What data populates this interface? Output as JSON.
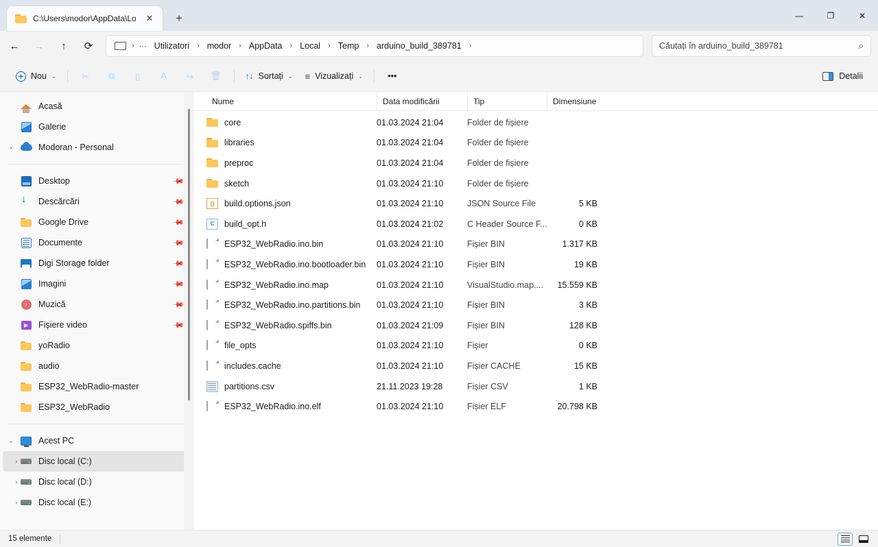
{
  "window": {
    "tab_title": "C:\\Users\\modor\\AppData\\Loc",
    "tab_close_label": "✕",
    "new_tab_label": "+",
    "minimize_label": "—",
    "maximize_label": "❐",
    "close_label": "✕"
  },
  "nav": {
    "back_label": "←",
    "forward_label": "→",
    "up_label": "↑",
    "refresh_label": "⟳"
  },
  "breadcrumb": {
    "overflow_label": "⋯",
    "separator": "›",
    "items": [
      {
        "label": "Utilizatori"
      },
      {
        "label": "modor"
      },
      {
        "label": "AppData"
      },
      {
        "label": "Local"
      },
      {
        "label": "Temp"
      },
      {
        "label": "arduino_build_389781"
      }
    ]
  },
  "search": {
    "placeholder": "Căutați în arduino_build_389781",
    "value": "",
    "icon_label": "⌕"
  },
  "toolbar": {
    "new_label": "Nou",
    "chevron": "⌄",
    "cut_label": "✂",
    "copy_label": "⧉",
    "paste_label": "▯",
    "rename_label": "A",
    "share_label": "↪",
    "delete_label": "🗑",
    "sort_label": "Sortați",
    "sort_icon": "↑↓",
    "view_label": "Vizualizați",
    "view_icon": "≡",
    "more_label": "•••",
    "details_label": "Detalii"
  },
  "sidebar": {
    "quick": [
      {
        "label": "Acasă",
        "icon": "home-icon",
        "chevron": "",
        "pinned": false
      },
      {
        "label": "Galerie",
        "icon": "gallery-icon",
        "chevron": "",
        "pinned": false
      },
      {
        "label": "Modoran - Personal",
        "icon": "onedrive-cloud-icon",
        "chevron": "›",
        "pinned": false
      }
    ],
    "pinned": [
      {
        "label": "Desktop",
        "icon": "desktop-icon",
        "pinned": true
      },
      {
        "label": "Descărcări",
        "icon": "downloads-icon",
        "pinned": true
      },
      {
        "label": "Google Drive",
        "icon": "folder-icon",
        "pinned": true
      },
      {
        "label": "Documente",
        "icon": "documents-icon",
        "pinned": true
      },
      {
        "label": "Digi Storage folder",
        "icon": "digi-storage-icon",
        "pinned": true
      },
      {
        "label": "Imagini",
        "icon": "pictures-icon",
        "pinned": true
      },
      {
        "label": "Muzică",
        "icon": "music-icon",
        "pinned": true
      },
      {
        "label": "Fișiere video",
        "icon": "video-icon",
        "pinned": true
      },
      {
        "label": "yoRadio",
        "icon": "folder-icon",
        "pinned": false
      },
      {
        "label": "audio",
        "icon": "folder-icon",
        "pinned": false
      },
      {
        "label": "ESP32_WebRadio-master",
        "icon": "folder-icon",
        "pinned": false
      },
      {
        "label": "ESP32_WebRadio",
        "icon": "folder-icon",
        "pinned": false
      }
    ],
    "thispc": {
      "label": "Acest PC",
      "chevron": "⌄",
      "icon": "this-pc-icon"
    },
    "drives": [
      {
        "label": "Disc local (C:)",
        "chevron": "›",
        "icon": "drive-icon",
        "selected": true
      },
      {
        "label": "Disc local (D:)",
        "chevron": "›",
        "icon": "drive-icon",
        "selected": false
      },
      {
        "label": "Disc local (E:)",
        "chevron": "›",
        "icon": "drive-icon",
        "selected": false
      }
    ],
    "pin_glyph": "📌"
  },
  "filelist": {
    "columns": {
      "name": "Nume",
      "date": "Data modificării",
      "type": "Tip",
      "size": "Dimensiune"
    },
    "sort_caret": "⌃",
    "rows": [
      {
        "name": "core",
        "date": "01.03.2024 21:04",
        "type": "Folder de fișiere",
        "size": "",
        "icon": "folder"
      },
      {
        "name": "libraries",
        "date": "01.03.2024 21:04",
        "type": "Folder de fișiere",
        "size": "",
        "icon": "folder"
      },
      {
        "name": "preproc",
        "date": "01.03.2024 21:04",
        "type": "Folder de fișiere",
        "size": "",
        "icon": "folder"
      },
      {
        "name": "sketch",
        "date": "01.03.2024 21:10",
        "type": "Folder de fișiere",
        "size": "",
        "icon": "folder"
      },
      {
        "name": "build.options.json",
        "date": "01.03.2024 21:10",
        "type": "JSON Source File",
        "size": "5 KB",
        "icon": "json"
      },
      {
        "name": "build_opt.h",
        "date": "01.03.2024 21:02",
        "type": "C Header Source F...",
        "size": "0 KB",
        "icon": "c"
      },
      {
        "name": "ESP32_WebRadio.ino.bin",
        "date": "01.03.2024 21:10",
        "type": "Fișier BIN",
        "size": "1.317 KB",
        "icon": "file"
      },
      {
        "name": "ESP32_WebRadio.ino.bootloader.bin",
        "date": "01.03.2024 21:10",
        "type": "Fișier BIN",
        "size": "19 KB",
        "icon": "file"
      },
      {
        "name": "ESP32_WebRadio.ino.map",
        "date": "01.03.2024 21:10",
        "type": "VisualStudio.map....",
        "size": "15.559 KB",
        "icon": "file"
      },
      {
        "name": "ESP32_WebRadio.ino.partitions.bin",
        "date": "01.03.2024 21:10",
        "type": "Fișier BIN",
        "size": "3 KB",
        "icon": "file"
      },
      {
        "name": "ESP32_WebRadio.spiffs.bin",
        "date": "01.03.2024 21:09",
        "type": "Fișier BIN",
        "size": "128 KB",
        "icon": "file"
      },
      {
        "name": "file_opts",
        "date": "01.03.2024 21:10",
        "type": "Fișier",
        "size": "0 KB",
        "icon": "file"
      },
      {
        "name": "includes.cache",
        "date": "01.03.2024 21:10",
        "type": "Fișier CACHE",
        "size": "15 KB",
        "icon": "file"
      },
      {
        "name": "partitions.csv",
        "date": "21.11.2023 19:28",
        "type": "Fișier CSV",
        "size": "1 KB",
        "icon": "csv"
      },
      {
        "name": "ESP32_WebRadio.ino.elf",
        "date": "01.03.2024 21:10",
        "type": "Fișier ELF",
        "size": "20.798 KB",
        "icon": "file"
      }
    ]
  },
  "statusbar": {
    "item_count": "15 elemente",
    "details_view_label": "≡",
    "pane_view_label": "▭"
  },
  "colors": {
    "accent": "#0b62c4",
    "folder": "#fcc75b",
    "titlebar_bg": "#dfe6ee",
    "selected_row": "#e4e4e4"
  }
}
